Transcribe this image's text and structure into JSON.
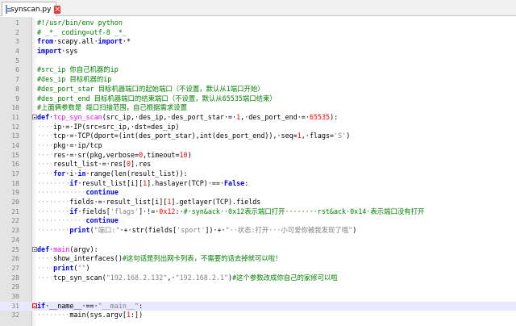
{
  "tab": {
    "filename": "synscan.py",
    "close_symbol": "×"
  },
  "colors": {
    "keyword": "#0000ff",
    "comment": "#008000",
    "string": "#808080",
    "number": "#ff0000",
    "builtin": "#ff00ff"
  },
  "lines": [
    {
      "n": "1",
      "spans": [
        [
          "cm",
          "#!/usr/bin/env python"
        ]
      ]
    },
    {
      "n": "2",
      "spans": [
        [
          "cm",
          "# _*_ coding=utf-8 _*_"
        ]
      ]
    },
    {
      "n": "3",
      "spans": [
        [
          "kw",
          "from"
        ],
        [
          "",
          "·scapy.all·"
        ],
        [
          "kw",
          "import"
        ],
        [
          "",
          "·*"
        ]
      ]
    },
    {
      "n": "4",
      "spans": [
        [
          "kw",
          "import"
        ],
        [
          "",
          "·sys"
        ]
      ]
    },
    {
      "n": "5",
      "spans": []
    },
    {
      "n": "6",
      "spans": [
        [
          "cm",
          "#src_ip 你自己机器的ip"
        ]
      ]
    },
    {
      "n": "7",
      "spans": [
        [
          "cm",
          "#des_ip 目标机器的ip"
        ]
      ]
    },
    {
      "n": "8",
      "spans": [
        [
          "cm",
          "#des_port_star 目标机器端口的起始端口（不设置，默认从1端口开始）"
        ]
      ]
    },
    {
      "n": "9",
      "spans": [
        [
          "cm",
          "#des_port_end 目标机器端口的结束端口（不设置，默认从65535端口结束）"
        ]
      ]
    },
    {
      "n": "10",
      "spans": [
        [
          "cm",
          "#上面俩参数是 端口扫描范围，自己根据需求设置"
        ]
      ]
    },
    {
      "n": "11",
      "spans": [
        [
          "kw",
          "def"
        ],
        [
          "",
          "·"
        ],
        [
          "fn",
          "tcp_syn_scan"
        ],
        [
          "",
          "(src_ip,·des_ip,·des_port_star·=·"
        ],
        [
          "num",
          "1"
        ],
        [
          "",
          ",·des_port_end·=·"
        ],
        [
          "num",
          "65535"
        ],
        [
          "",
          "):"
        ]
      ],
      "fold": true
    },
    {
      "n": "12",
      "spans": [
        [
          "ws",
          "····"
        ],
        [
          "",
          "ip·=·IP(src=src_ip,·dst=des_ip)"
        ]
      ]
    },
    {
      "n": "13",
      "spans": [
        [
          "ws",
          "····"
        ],
        [
          "",
          "tcp·=·TCP(dport=(int(des_port_star),int(des_port_end)),·seq="
        ],
        [
          "num",
          "1"
        ],
        [
          "",
          ",·flags="
        ],
        [
          "str",
          "'S'"
        ],
        [
          "",
          ")"
        ]
      ]
    },
    {
      "n": "14",
      "spans": [
        [
          "ws",
          "····"
        ],
        [
          "",
          "pkg·=·ip/tcp"
        ]
      ]
    },
    {
      "n": "15",
      "spans": [
        [
          "ws",
          "····"
        ],
        [
          "",
          "res·=·sr(pkg,verbose="
        ],
        [
          "num",
          "0"
        ],
        [
          "",
          ",timeout="
        ],
        [
          "num",
          "10"
        ],
        [
          "",
          ")"
        ]
      ]
    },
    {
      "n": "16",
      "spans": [
        [
          "ws",
          "····"
        ],
        [
          "",
          "result_list·=·res["
        ],
        [
          "num",
          "0"
        ],
        [
          "",
          "].res"
        ]
      ]
    },
    {
      "n": "17",
      "spans": [
        [
          "ws",
          "····"
        ],
        [
          "kw",
          "for"
        ],
        [
          "",
          "·i·"
        ],
        [
          "kw",
          "in"
        ],
        [
          "",
          "·range(len(result_list)):"
        ]
      ]
    },
    {
      "n": "18",
      "spans": [
        [
          "ws",
          "········"
        ],
        [
          "kw",
          "if"
        ],
        [
          "",
          "·result_list[i]["
        ],
        [
          "num",
          "1"
        ],
        [
          "",
          "].haslayer(TCP)·==·"
        ],
        [
          "kw",
          "False"
        ],
        [
          "",
          ":"
        ]
      ]
    },
    {
      "n": "19",
      "spans": [
        [
          "ws",
          "············"
        ],
        [
          "kw",
          "continue"
        ]
      ]
    },
    {
      "n": "20",
      "spans": [
        [
          "ws",
          "········"
        ],
        [
          "",
          "fields·=·result_list[i]["
        ],
        [
          "num",
          "1"
        ],
        [
          "",
          "].getlayer(TCP).fields"
        ]
      ]
    },
    {
      "n": "21",
      "spans": [
        [
          "ws",
          "········"
        ],
        [
          "kw",
          "if"
        ],
        [
          "",
          "·fields["
        ],
        [
          "str",
          "'flags'"
        ],
        [
          "",
          "]·!=·"
        ],
        [
          "num",
          "0x12"
        ],
        [
          "",
          ":·"
        ],
        [
          "cm",
          "#·syn&ack··0x12表示端口打开········rst&ack·0x14·表示端口没有打开"
        ]
      ]
    },
    {
      "n": "22",
      "spans": [
        [
          "ws",
          "············"
        ],
        [
          "kw",
          "continue"
        ]
      ]
    },
    {
      "n": "23",
      "spans": [
        [
          "ws",
          "········"
        ],
        [
          "kw",
          "print"
        ],
        [
          "",
          "("
        ],
        [
          "str",
          "\"端口:\""
        ],
        [
          "",
          "·+·str(fields["
        ],
        [
          "str",
          "'sport'"
        ],
        [
          "",
          "])·+·"
        ],
        [
          "str",
          "\"··状态:打开···小可爱你被我发现了哦\""
        ],
        [
          "",
          ")"
        ]
      ]
    },
    {
      "n": "24",
      "spans": []
    },
    {
      "n": "25",
      "spans": [
        [
          "kw",
          "def"
        ],
        [
          "",
          "·"
        ],
        [
          "fn",
          "main"
        ],
        [
          "",
          "(argv):"
        ]
      ],
      "fold": true
    },
    {
      "n": "26",
      "spans": [
        [
          "ws",
          "····"
        ],
        [
          "",
          "show_interfaces()"
        ],
        [
          "cm",
          "#这句话是列出网卡列表，不需要的话去掉就可以啦！"
        ]
      ]
    },
    {
      "n": "27",
      "spans": [
        [
          "ws",
          "····"
        ],
        [
          "kw",
          "print"
        ],
        [
          "",
          "("
        ],
        [
          "str",
          "\"\""
        ],
        [
          "",
          ")"
        ]
      ]
    },
    {
      "n": "28",
      "spans": [
        [
          "ws",
          "····"
        ],
        [
          "",
          "tcp_syn_scan("
        ],
        [
          "str",
          "\"192.168.2.132\""
        ],
        [
          "",
          ",·"
        ],
        [
          "str",
          "\"192.168.2.1\""
        ],
        [
          "",
          ")"
        ],
        [
          "cm",
          "#这个参数改成你自己的家修可以啦"
        ]
      ]
    },
    {
      "n": "29",
      "spans": []
    },
    {
      "n": "30",
      "spans": []
    },
    {
      "n": "31",
      "spans": [
        [
          "kw",
          "if"
        ],
        [
          "",
          "·__name__·==·"
        ],
        [
          "str",
          "\"__main__\""
        ],
        [
          "",
          ":"
        ]
      ],
      "fold": true,
      "red": true,
      "current": true
    },
    {
      "n": "32",
      "spans": [
        [
          "ws",
          "········"
        ],
        [
          "",
          "main(sys.argv["
        ],
        [
          "num",
          "1"
        ],
        [
          "",
          ":])"
        ]
      ]
    }
  ]
}
